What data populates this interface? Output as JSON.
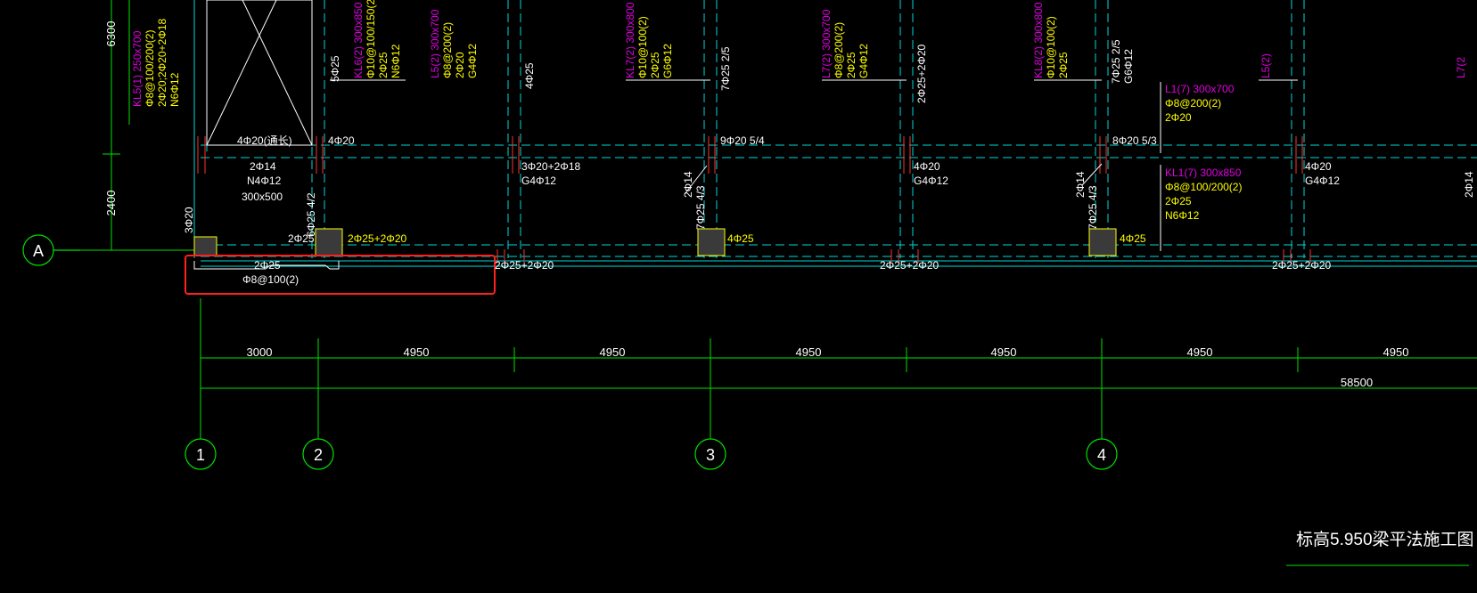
{
  "drawing": {
    "title": "标高5.950梁平法施工图",
    "colors": {
      "background": "#000000",
      "grid": "#00e000",
      "beam_dash": "#00d8d8",
      "beam_label": "#e000e0",
      "rebar": "#ffff00",
      "white": "#ffffff",
      "column_tick": "#ff3030",
      "highlight": "#ff2020"
    },
    "axes": {
      "row": "A",
      "columns": [
        "1",
        "2",
        "3",
        "4"
      ]
    },
    "dimensions": {
      "vertical": [
        "6300",
        "2400"
      ],
      "spans": [
        "3000",
        "4950",
        "4950",
        "4950",
        "4950",
        "4950",
        "4950"
      ],
      "total": "58500"
    },
    "beam_labels": {
      "kl5": "KL5(1) 250x700",
      "kl5_stirrup": "Φ8@100/200(2)",
      "kl5_main": "2Φ20;2Φ20+2Φ18",
      "kl5_side": "N6Φ12",
      "kl6": "KL6(2) 300x850",
      "kl6_stirrup": "Φ10@100/150(2)",
      "kl6_main": "2Φ25",
      "kl6_side": "N6Φ12",
      "l5a": "L5(2) 300x700",
      "l5a_stirrup": "Φ8@200(2)",
      "l5a_main": "2Φ20",
      "l5a_side": "G4Φ12",
      "kl7": "KL7(2) 300x800",
      "kl7_stirrup": "Φ10@100(2)",
      "kl7_main": "2Φ25",
      "kl7_side": "G6Φ12",
      "l7": "L7(2) 300x700",
      "l7_stirrup": "Φ8@200(2)",
      "l7_main": "2Φ25",
      "l7_side": "G4Φ12",
      "kl8": "KL8(2) 300x800",
      "kl8_stirrup": "Φ10@100(2)",
      "kl8_main": "2Φ25",
      "l1": "L1(7) 300x700",
      "l1_stirrup": "Φ8@200(2)",
      "l1_main": "2Φ20",
      "l5b": "L5(2)",
      "kl1": "KL1(7) 300x850",
      "kl1_stirrup": "Φ8@100/200(2)",
      "kl1_main": "2Φ25",
      "kl1_side": "N6Φ12",
      "l7b": "L7(2"
    },
    "rebar_notes": {
      "v_5p25": "5Φ25",
      "v_4p25": "4Φ25",
      "v_7p25": "7Φ25 2/5",
      "v_2p25_2p20": "2Φ25+2Φ20",
      "v_7p25b": "7Φ25 2/5",
      "v_g6": "G6Φ12",
      "t_4p20": "4Φ20(通长)",
      "t_4p20b": "4Φ20",
      "t_9p20": "9Φ20 5/4",
      "t_8p20": "8Φ20 5/3",
      "m_3p20": "3Φ20+2Φ18",
      "m_g4a": "G4Φ12",
      "m_4p20a": "4Φ20",
      "m_g4b": "G4Φ12",
      "m_4p20b": "4Φ20",
      "m_g4c": "G4Φ12",
      "b_2p14": "2Φ14",
      "b_n4": "N4Φ12",
      "b_300x500": "300x500",
      "v_3p20": "3Φ20",
      "v_6p25": "6Φ25 4/2",
      "v_2p14a": "2Φ14",
      "v_7p25c": "7Φ25 4/3",
      "v_2p14b": "2Φ14",
      "v_7p25d": "7Φ25 4/3",
      "v_2p14c": "2Φ14",
      "l_2p25": "2Φ25",
      "l_2p25_2p20": "2Φ25+2Φ20",
      "l_4p25a": "4Φ25",
      "l_4p25b": "4Φ25",
      "cant_2p25": "2Φ25",
      "cant_stirrup": "Φ8@100(2)",
      "bot_a": "2Φ25+2Φ20",
      "bot_b": "2Φ25+2Φ20",
      "bot_c": "2Φ25+2Φ20"
    }
  }
}
